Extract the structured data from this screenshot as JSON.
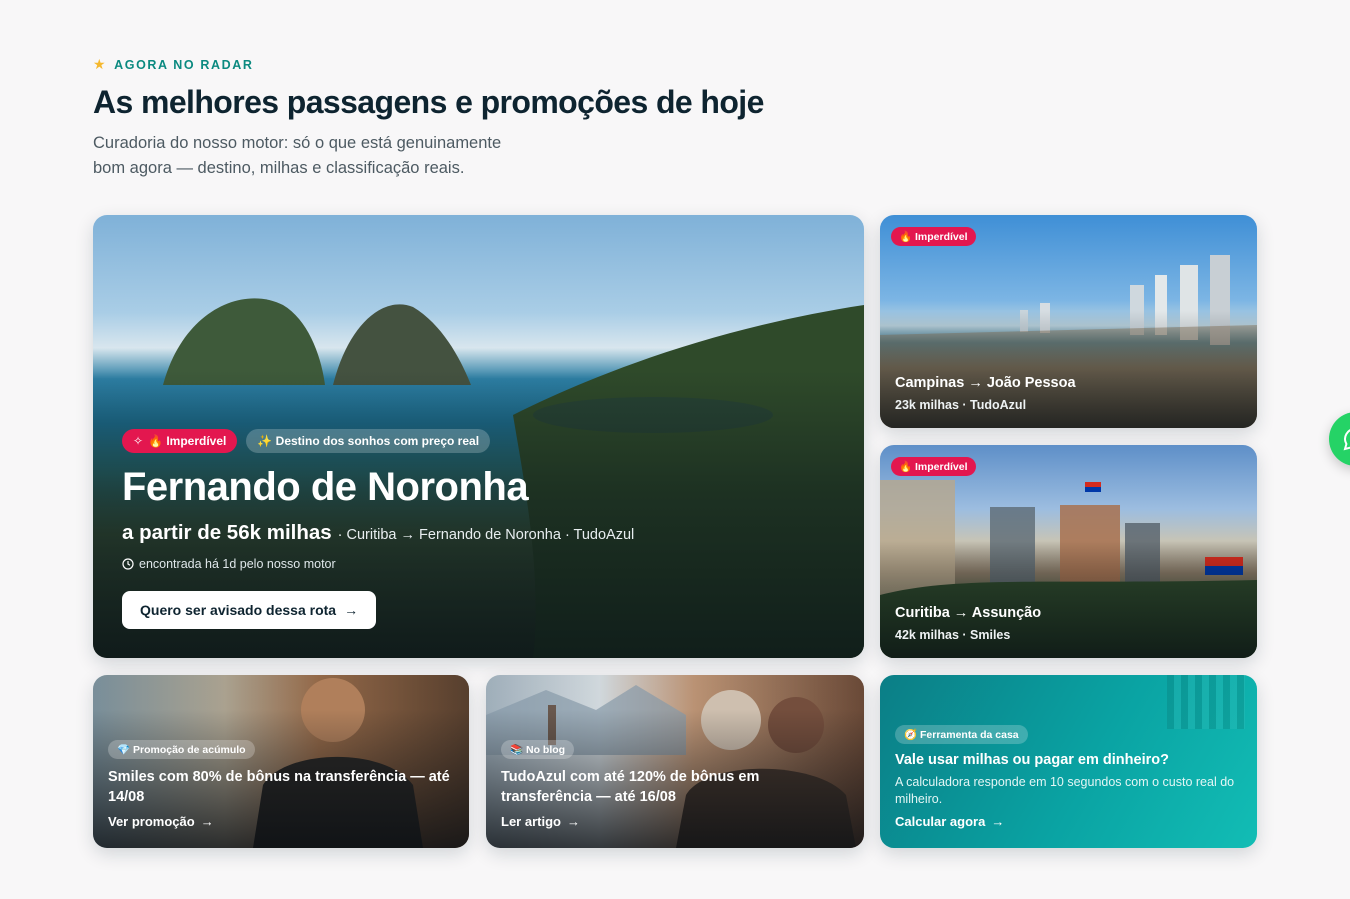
{
  "section": {
    "eyebrow": "AGORA NO RADAR",
    "eyebrow_icon": "star-icon",
    "title": "As melhores passagens e promoções de hoje",
    "lead": "Curadoria do nosso motor: só o que está genuinamente bom agora — destino, milhas e classificação reais."
  },
  "hero": {
    "badge_hot": "🔥 Imperdível",
    "badge_tag": "✨ Destino dos sonhos com preço real",
    "destination": "Fernando de Noronha",
    "price": "a partir de 56k milhas",
    "route": "· Curitiba → Fernando de Noronha · TudoAzul",
    "found": "encontrada há 1d pelo nosso motor",
    "cta": "Quero ser avisado dessa rota"
  },
  "side_cards": [
    {
      "badge": "🔥 Imperdível",
      "title": "Campinas → João Pessoa",
      "meta": "23k milhas · TudoAzul"
    },
    {
      "badge": "🔥 Imperdível",
      "title": "Curitiba → Assunção",
      "meta": "42k milhas · Smiles"
    }
  ],
  "promo": {
    "badge": "💎 Promoção de acúmulo",
    "title": "Smiles com 80% de bônus na transferência — até 14/08",
    "link": "Ver promoção"
  },
  "blog": {
    "badge": "📚 No blog",
    "title": "TudoAzul com até 120% de bônus em transferência — até 16/08",
    "link": "Ler artigo"
  },
  "tool": {
    "badge": "🧭 Ferramenta da casa",
    "title": "Vale usar milhas ou pagar em dinheiro?",
    "desc": "A calculadora responde em 10 segundos com o custo real do milheiro.",
    "link": "Calcular agora"
  },
  "colors": {
    "accent": "#0b8a80",
    "hot": "#e3174f",
    "tool_bg": "#0aa3a3",
    "whatsapp": "#25d366"
  }
}
